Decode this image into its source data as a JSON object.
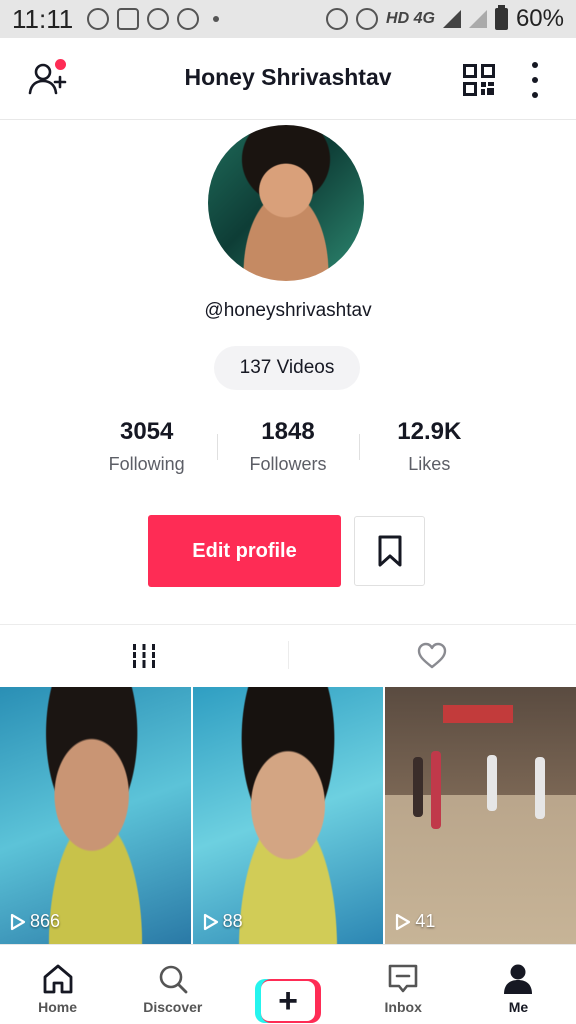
{
  "status_bar": {
    "time": "11:11",
    "network": "HD 4G",
    "battery": "60%"
  },
  "header": {
    "title": "Honey Shrivashtav",
    "icons": [
      "add-user-icon",
      "qr-code-icon",
      "more-icon"
    ],
    "notification_dot_color": "#fe2c55"
  },
  "profile": {
    "username": "@honeyshrivashtav",
    "videos_label": "137 Videos"
  },
  "stats": [
    {
      "value": "3054",
      "label": "Following"
    },
    {
      "value": "1848",
      "label": "Followers"
    },
    {
      "value": "12.9K",
      "label": "Likes"
    }
  ],
  "actions": {
    "edit_profile": "Edit profile",
    "accent_color": "#fe2c55"
  },
  "tabs": [
    {
      "icon": "grid-icon",
      "active": true
    },
    {
      "icon": "heart-icon",
      "active": false
    }
  ],
  "videos": [
    {
      "views": "866"
    },
    {
      "views": "88"
    },
    {
      "views": "41"
    }
  ],
  "bottom_nav": {
    "home": "Home",
    "discover": "Discover",
    "inbox": "Inbox",
    "me": "Me"
  }
}
